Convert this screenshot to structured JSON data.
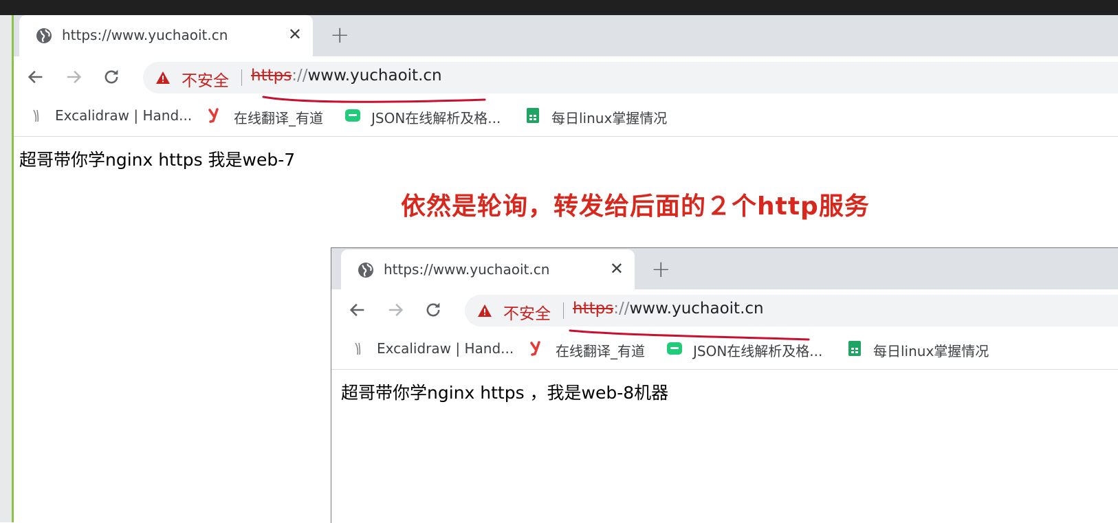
{
  "annotation": "依然是轮询，转发给后面的２个http服务",
  "accent_color": "#d8281e",
  "windows": [
    {
      "tab_title": "https://www.yuchaoit.cn",
      "tab_close": "✕",
      "new_tab": "+",
      "not_secure": "不安全",
      "url_scheme": "https",
      "url_sep": "://",
      "url_host": "www.yuchaoit.cn",
      "bookmarks": [
        "Excalidraw | Hand...",
        "在线翻译_有道",
        "JSON在线解析及格...",
        "每日linux掌握情况"
      ],
      "page_text": "超哥带你学nginx https 我是web-7"
    },
    {
      "tab_title": "https://www.yuchaoit.cn",
      "tab_close": "✕",
      "new_tab": "+",
      "not_secure": "不安全",
      "url_scheme": "https",
      "url_sep": "://",
      "url_host": "www.yuchaoit.cn",
      "bookmarks": [
        "Excalidraw | Hand...",
        "在线翻译_有道",
        "JSON在线解析及格...",
        "每日linux掌握情况"
      ],
      "page_text": "超哥带你学nginx https ，我是web-8机器"
    }
  ],
  "icons": [
    "globe-icon",
    "close-icon",
    "plus-icon",
    "back-arrow-icon",
    "forward-arrow-icon",
    "reload-icon",
    "warning-icon",
    "excalidraw-icon",
    "youdao-icon",
    "json-icon",
    "sheets-icon"
  ]
}
